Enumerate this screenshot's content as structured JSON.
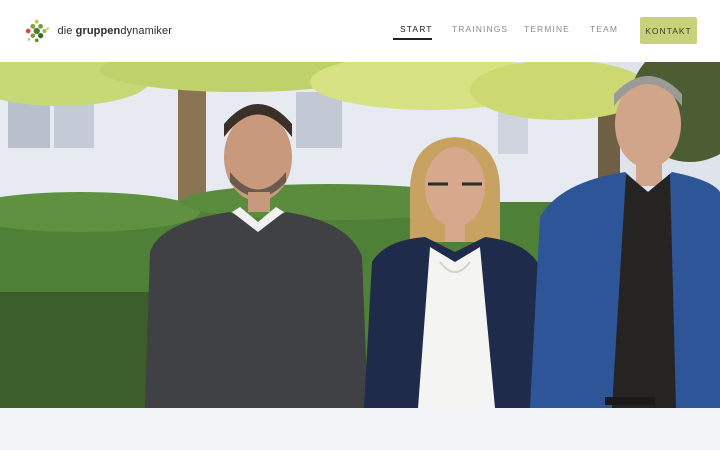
{
  "brand": {
    "prefix": "die ",
    "bold": "gruppen",
    "suffix": "dynamiker"
  },
  "nav": {
    "items": [
      {
        "label": "START",
        "active": true
      },
      {
        "label": "TRAININGS",
        "active": false
      },
      {
        "label": "TERMINE",
        "active": false
      },
      {
        "label": "TEAM",
        "active": false
      }
    ],
    "cta_label": "KONTAKT"
  },
  "colors": {
    "accent": "#c8d27a",
    "text_dark": "#222222",
    "nav_muted": "#8a8a8a"
  },
  "hero": {
    "image_alt": "Team photo of three people standing outdoors in front of a hedge and blossoming tree"
  }
}
